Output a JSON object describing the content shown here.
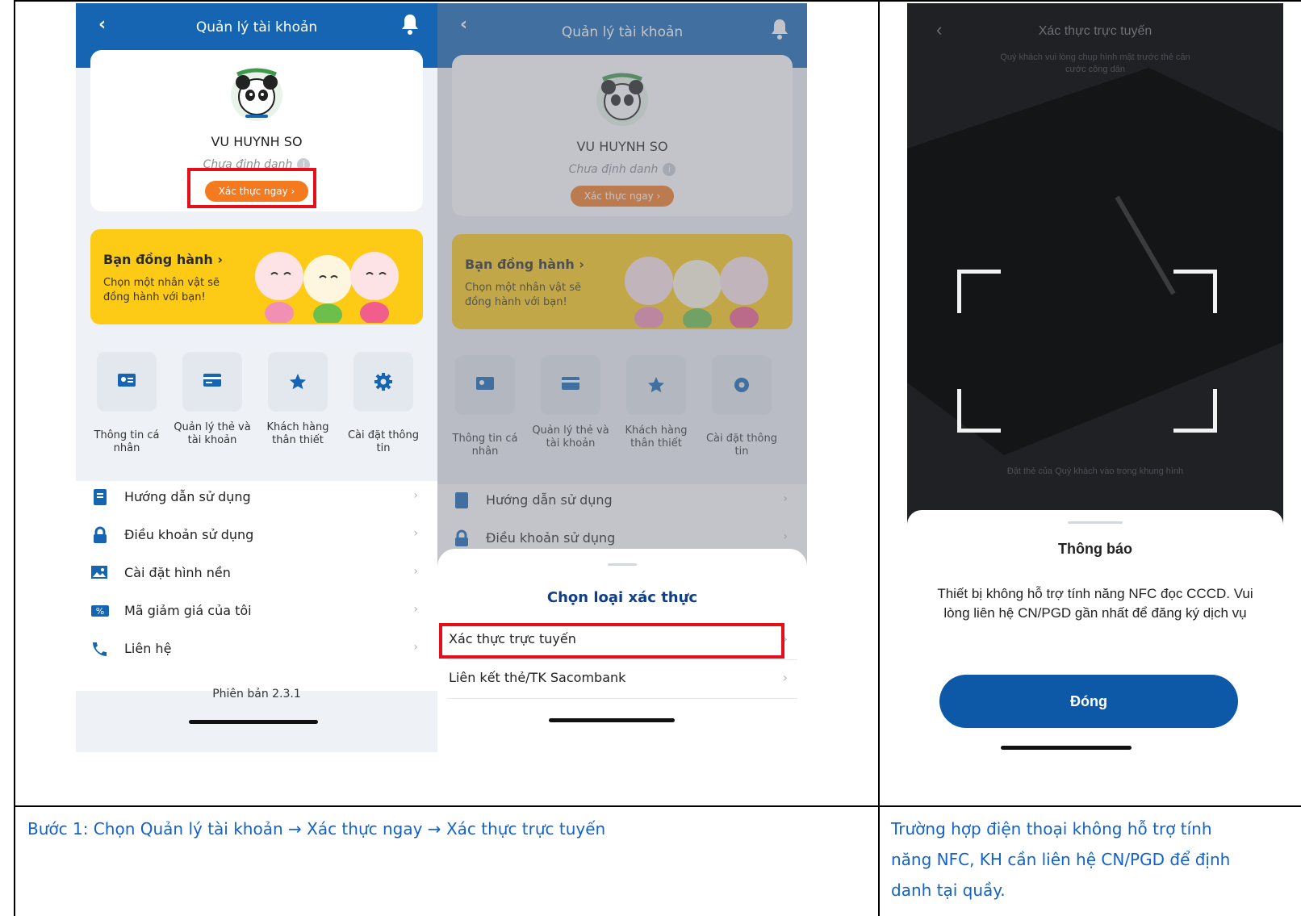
{
  "screen1": {
    "header_title": "Quản lý tài khoản",
    "user_name": "VU HUYNH SO",
    "user_status": "Chưa định danh",
    "verify_button": "Xác thực ngay",
    "companion_title": "Bạn đồng hành ›",
    "companion_subtitle": "Chọn một nhân vật sẽ đồng hành với bạn!",
    "quick_actions": [
      {
        "label": "Thông tin cá nhân",
        "icon": "id-card-icon"
      },
      {
        "label": "Quản lý thẻ và tài khoản",
        "icon": "card-icon"
      },
      {
        "label": "Khách hàng thân thiết",
        "icon": "star-icon"
      },
      {
        "label": "Cài đặt thông tin",
        "icon": "gear-icon"
      }
    ],
    "menu": [
      {
        "label": "Hướng dẫn sử dụng",
        "icon": "book-icon"
      },
      {
        "label": "Điều khoản sử dụng",
        "icon": "lock-icon"
      },
      {
        "label": "Cài đặt hình nền",
        "icon": "wallpaper-icon"
      },
      {
        "label": "Mã giảm giá của tôi",
        "icon": "percent-icon"
      },
      {
        "label": "Liên hệ",
        "icon": "phone-icon"
      }
    ],
    "version": "Phiên bản 2.3.1"
  },
  "screen2": {
    "header_title": "Quản lý tài khoản",
    "user_name": "VU HUYNH SO",
    "user_status": "Chưa định danh",
    "verify_button": "Xác thực ngay",
    "companion_title": "Bạn đồng hành ›",
    "companion_subtitle": "Chọn một nhân vật sẽ đồng hành với bạn!",
    "quick_actions": [
      {
        "label": "Thông tin cá nhân"
      },
      {
        "label": "Quản lý thẻ và tài khoản"
      },
      {
        "label": "Khách hàng thân thiết"
      },
      {
        "label": "Cài đặt thông tin"
      }
    ],
    "menu": [
      {
        "label": "Hướng dẫn sử dụng"
      },
      {
        "label": "Điều khoản sử dụng"
      }
    ],
    "sheet_title": "Chọn loại xác thực",
    "sheet_options": [
      "Xác thực trực tuyến",
      "Liên kết thẻ/TK Sacombank"
    ]
  },
  "screen3": {
    "header_title": "Xác thực trực tuyến",
    "header_subtitle": "Quý khách vui lòng chụp hình mặt trước thẻ căn cước công dân",
    "frame_hint": "Đặt thẻ của Quý khách vào trong khung hình",
    "dialog_title": "Thông báo",
    "dialog_message": "Thiết bị không hỗ trợ tính năng NFC đọc CCCD. Vui lòng liên hệ CN/PGD gần nhất để đăng ký dịch vụ",
    "close_button": "Đóng"
  },
  "captions": {
    "step1_prefix": "Bước 1:",
    "step1_chon": " Chọn ",
    "step1_a": "Quản lý tài khoản",
    "arrow": " → ",
    "step1_b": "Xác thực ngay",
    "step1_c": "Xác thực trực tuyến",
    "note_line1": "Trường hợp điện thoại không hỗ trợ tính",
    "note_line2": "năng NFC, KH cần liên hệ CN/PGD để định",
    "note_line3": "danh tại quầy."
  },
  "colors": {
    "brand_blue": "#1565b3",
    "orange": "#f47a20",
    "highlight_red": "#e3101b",
    "companion_yellow": "#fdcb15",
    "caption_blue": "#1263c9"
  }
}
